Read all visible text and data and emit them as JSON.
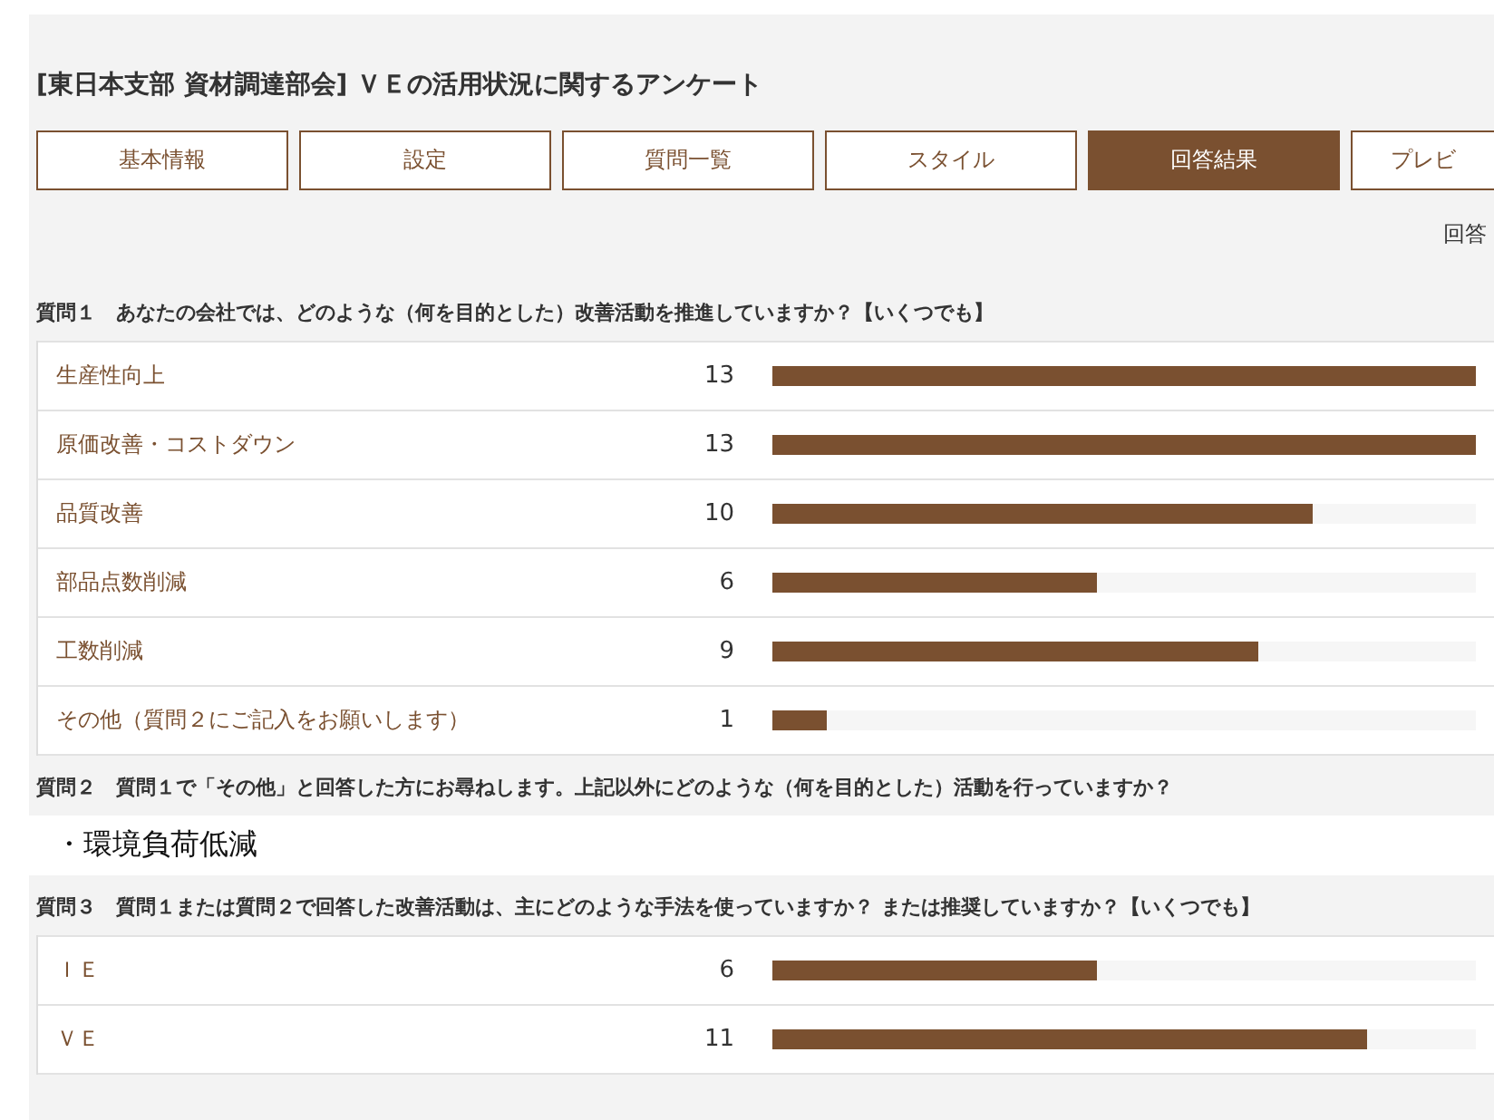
{
  "title": "[東日本支部 資材調達部会] ＶＥの活用状況に関するアンケート",
  "tabs": [
    {
      "label": "基本情報",
      "selected": false
    },
    {
      "label": "設定",
      "selected": false
    },
    {
      "label": "質問一覧",
      "selected": false
    },
    {
      "label": "スタイル",
      "selected": false
    },
    {
      "label": "回答結果",
      "selected": true
    },
    {
      "label": "プレビ",
      "selected": false
    }
  ],
  "response_count_label": "回答",
  "questions": [
    {
      "kind": "bars",
      "title": "質問１　あなたの会社では、どのような（何を目的とした）改善活動を推進していますか？【いくつでも】",
      "options": [
        {
          "label": "生産性向上",
          "count": "13",
          "level": 1
        },
        {
          "label": "原価改善・コストダウン",
          "count": "13",
          "level": 1
        },
        {
          "label": "品質改善",
          "count": "10",
          "level": 0.769
        },
        {
          "label": "部品点数削減",
          "count": "6",
          "level": 0.462
        },
        {
          "label": "工数削減",
          "count": "9",
          "level": 0.692
        },
        {
          "label": "その他（質問２にご記入をお願いします）",
          "count": "1",
          "level": 0.077
        }
      ]
    },
    {
      "kind": "text",
      "title": "質問２　質問１で「その他」と回答した方にお尋ねします。上記以外にどのような（何を目的とした）活動を行っていますか？",
      "answer": "・環境負荷低減"
    },
    {
      "kind": "bars",
      "title": "質問３　質問１または質問２で回答した改善活動は、主にどのような手法を使っていますか？ または推奨していますか？【いくつでも】",
      "options": [
        {
          "label": "ＩＥ",
          "count": "6",
          "level": 0.462
        },
        {
          "label": "ＶＥ",
          "count": "11",
          "level": 0.846
        }
      ]
    }
  ]
}
